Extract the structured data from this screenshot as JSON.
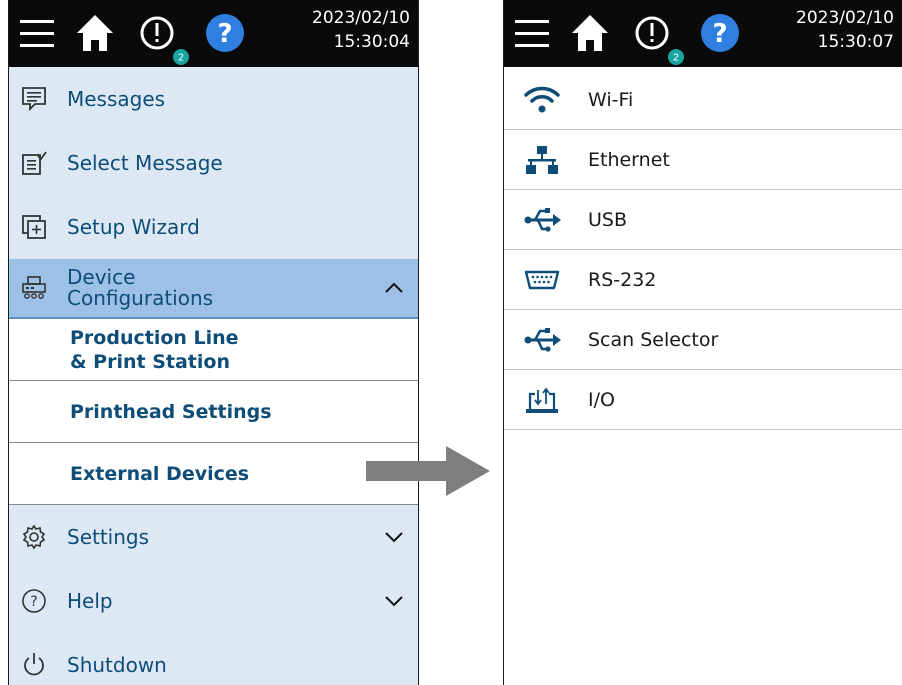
{
  "left_screen": {
    "topbar": {
      "date": "2023/02/10",
      "time": "15:30:04",
      "alert_count": "2"
    },
    "menu": {
      "messages": "Messages",
      "select_message": "Select Message",
      "setup_wizard": "Setup Wizard",
      "device_config_line1": "Device",
      "device_config_line2": "Configurations",
      "submenu": {
        "production_line_1": "Production Line",
        "production_line_2": "& Print Station",
        "printhead_settings": "Printhead Settings",
        "external_devices": "External Devices"
      },
      "settings": "Settings",
      "help": "Help",
      "shutdown": "Shutdown"
    }
  },
  "right_screen": {
    "topbar": {
      "date": "2023/02/10",
      "time": "15:30:07",
      "alert_count": "2"
    },
    "items": [
      {
        "label": "Wi-Fi",
        "icon": "wifi-icon"
      },
      {
        "label": "Ethernet",
        "icon": "ethernet-icon"
      },
      {
        "label": "USB",
        "icon": "usb-icon"
      },
      {
        "label": "RS-232",
        "icon": "serial-port-icon"
      },
      {
        "label": "Scan Selector",
        "icon": "usb-icon"
      },
      {
        "label": "I/O",
        "icon": "io-icon"
      }
    ]
  },
  "colors": {
    "topbar": "#0a0a0a",
    "menu_bg": "#dde8f4",
    "menu_active": "#9dc0e6",
    "menu_text": "#0d4d78",
    "help_blue": "#2f7fe0",
    "badge": "#1aa5a0"
  }
}
